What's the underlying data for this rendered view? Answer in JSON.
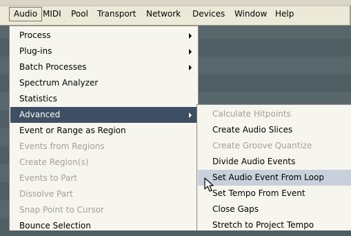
{
  "menubar": {
    "items": [
      "Audio",
      "MIDI",
      "Pool",
      "Transport",
      "Network",
      "Devices",
      "Window",
      "Help"
    ]
  },
  "audio_menu": {
    "items": [
      {
        "label": "Process",
        "submenu": true,
        "state": "enabled"
      },
      {
        "label": "Plug-ins",
        "submenu": true,
        "state": "enabled"
      },
      {
        "label": "Batch Processes",
        "submenu": true,
        "state": "enabled"
      },
      {
        "label": "Spectrum Analyzer",
        "submenu": false,
        "state": "enabled"
      },
      {
        "label": "Statistics",
        "submenu": false,
        "state": "enabled"
      },
      {
        "label": "Advanced",
        "submenu": true,
        "state": "highlighted"
      },
      {
        "label": "Event or Range as Region",
        "submenu": false,
        "state": "enabled"
      },
      {
        "label": "Events from Regions",
        "submenu": false,
        "state": "disabled"
      },
      {
        "label": "Create Region(s)",
        "submenu": false,
        "state": "disabled"
      },
      {
        "label": "Events to Part",
        "submenu": false,
        "state": "disabled"
      },
      {
        "label": "Dissolve Part",
        "submenu": false,
        "state": "disabled"
      },
      {
        "label": "Snap Point to Cursor",
        "submenu": false,
        "state": "disabled"
      },
      {
        "label": "Bounce Selection",
        "submenu": false,
        "state": "enabled"
      }
    ]
  },
  "advanced_submenu": {
    "items": [
      {
        "label": "Calculate Hitpoints",
        "state": "disabled"
      },
      {
        "label": "Create Audio Slices",
        "state": "enabled"
      },
      {
        "label": "Create Groove Quantize",
        "state": "disabled"
      },
      {
        "label": "Divide Audio Events",
        "state": "enabled"
      },
      {
        "label": "Set Audio Event From Loop",
        "state": "hovered"
      },
      {
        "label": "Set Tempo From Event",
        "state": "enabled"
      },
      {
        "label": "Close Gaps",
        "state": "enabled"
      },
      {
        "label": "Stretch to Project Tempo",
        "state": "enabled"
      }
    ]
  },
  "icons": {
    "submenu_arrow": "chevron-right-icon",
    "cursor": "mouse-pointer-icon"
  },
  "colors": {
    "menu_background": "#f6f5ee",
    "highlight": "#3f4f63",
    "hover": "#c8d0dc",
    "disabled_text": "#a3a095",
    "workspace": "#58676b"
  }
}
